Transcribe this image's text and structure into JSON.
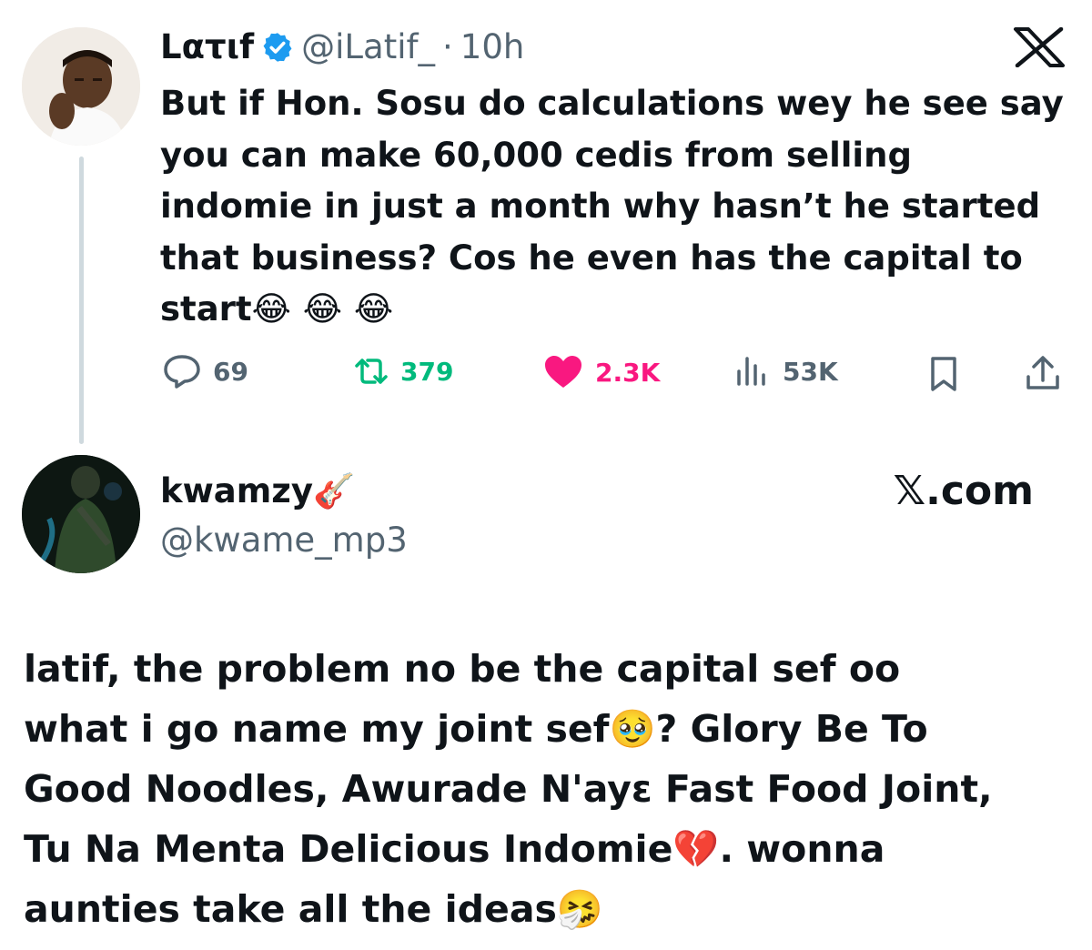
{
  "tweet": {
    "display_name": "Lατιf",
    "handle": "@iLatif_",
    "separator": "·",
    "time": "10h",
    "lines": [
      "But if Hon. Sosu do calculations wey he see say",
      "you can make 60,000 cedis from selling",
      "indomie in just a month why hasn’t he started",
      "that business? Cos he even has the capital to",
      "start😂 😂 😂"
    ],
    "metrics": {
      "replies": "69",
      "reposts": "379",
      "likes": "2.3K",
      "views": "53K"
    },
    "colors": {
      "repost": "#00ba7c",
      "like": "#f91880",
      "muted": "#536471",
      "verified": "#1d9bf0"
    }
  },
  "reply": {
    "display_name": "kwamzy🎸",
    "handle": "@kwame_mp3",
    "brand": "𝕏.com",
    "lines": [
      "latif, the problem no be the capital sef oo",
      "what i go name my joint sef🥹? Glory Be To",
      "Good Noodles, Awurade N'ayɛ Fast Food Joint,",
      "Tu Na Menta Delicious Indomie💔. wonna",
      "aunties take all the ideas🤧"
    ]
  },
  "icons": [
    "x-logo-icon",
    "verified-badge-icon",
    "reply-icon",
    "repost-icon",
    "like-icon",
    "views-icon",
    "bookmark-icon",
    "share-icon"
  ]
}
